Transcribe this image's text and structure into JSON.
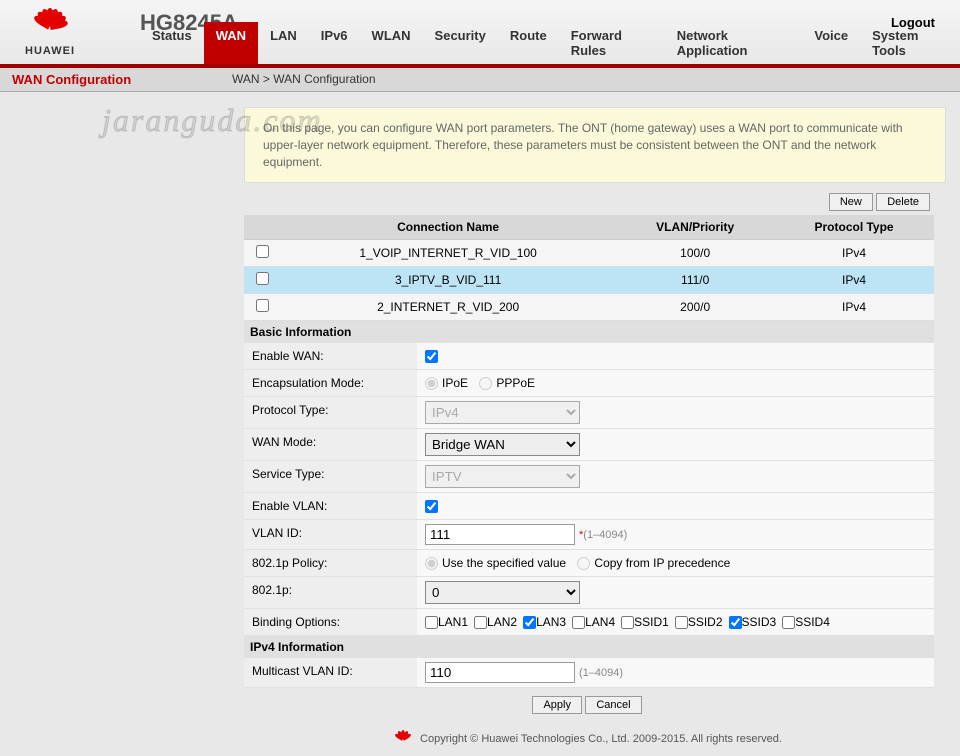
{
  "header": {
    "brand": "HUAWEI",
    "model": "HG8245A",
    "logout": "Logout"
  },
  "nav": {
    "tabs": [
      "Status",
      "WAN",
      "LAN",
      "IPv6",
      "WLAN",
      "Security",
      "Route",
      "Forward Rules",
      "Network Application",
      "Voice",
      "System Tools"
    ],
    "active": "WAN"
  },
  "sidebar": {
    "title": "WAN Configuration"
  },
  "breadcrumb": "WAN > WAN Configuration",
  "infobox": "On this page, you can configure WAN port parameters. The ONT (home gateway) uses a WAN port to communicate with upper-layer network equipment. Therefore, these parameters must be consistent between the ONT and the network equipment.",
  "toolbar": {
    "new": "New",
    "delete": "Delete"
  },
  "conntable": {
    "headers": {
      "name": "Connection Name",
      "vlan": "VLAN/Priority",
      "proto": "Protocol Type"
    },
    "rows": [
      {
        "name": "1_VOIP_INTERNET_R_VID_100",
        "vlan": "100/0",
        "proto": "IPv4"
      },
      {
        "name": "3_IPTV_B_VID_111",
        "vlan": "111/0",
        "proto": "IPv4"
      },
      {
        "name": "2_INTERNET_R_VID_200",
        "vlan": "200/0",
        "proto": "IPv4"
      }
    ]
  },
  "basic": {
    "title": "Basic Information",
    "enable_wan_label": "Enable WAN:",
    "enable_wan": true,
    "encap_label": "Encapsulation Mode:",
    "encap_ipoe": "IPoE",
    "encap_pppoe": "PPPoE",
    "proto_label": "Protocol Type:",
    "proto_value": "IPv4",
    "wanmode_label": "WAN Mode:",
    "wanmode_value": "Bridge WAN",
    "service_label": "Service Type:",
    "service_value": "IPTV",
    "enable_vlan_label": "Enable VLAN:",
    "enable_vlan": true,
    "vlanid_label": "VLAN ID:",
    "vlanid_value": "111",
    "vlanid_hint": "(1–4094)",
    "policy_label": "802.1p Policy:",
    "policy_spec": "Use the specified value",
    "policy_copy": "Copy from IP precedence",
    "p8021_label": "802.1p:",
    "p8021_value": "0",
    "bind_label": "Binding Options:",
    "bind_opts": [
      {
        "label": "LAN1",
        "checked": false
      },
      {
        "label": "LAN2",
        "checked": false
      },
      {
        "label": "LAN3",
        "checked": true
      },
      {
        "label": "LAN4",
        "checked": false
      },
      {
        "label": "SSID1",
        "checked": false
      },
      {
        "label": "SSID2",
        "checked": false
      },
      {
        "label": "SSID3",
        "checked": true
      },
      {
        "label": "SSID4",
        "checked": false
      }
    ]
  },
  "ipv4": {
    "title": "IPv4 Information",
    "mvlan_label": "Multicast VLAN ID:",
    "mvlan_value": "110",
    "mvlan_hint": "(1–4094)"
  },
  "actions": {
    "apply": "Apply",
    "cancel": "Cancel"
  },
  "footer": "Copyright © Huawei Technologies Co., Ltd. 2009-2015. All rights reserved.",
  "watermark": "jaranguda.com"
}
